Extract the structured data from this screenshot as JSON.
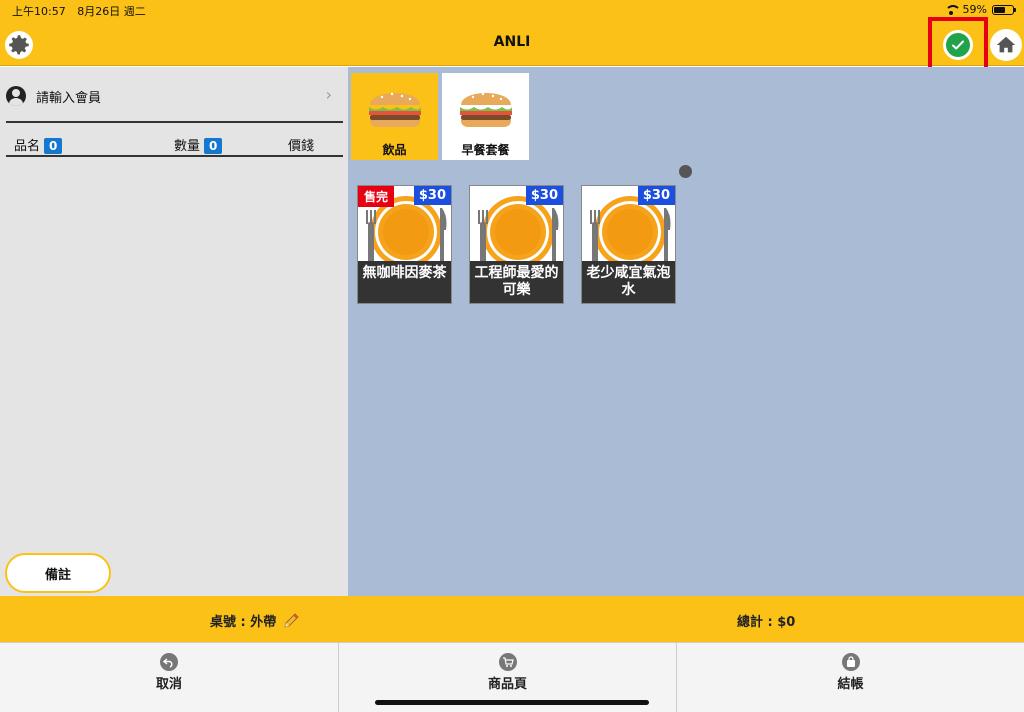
{
  "status_bar": {
    "time": "上午10:57",
    "date": "8月26日 週二",
    "battery": "59%",
    "battery_level": 0.59
  },
  "header": {
    "title": "ANLI"
  },
  "member": {
    "placeholder": "請輸入會員"
  },
  "order_columns": {
    "name": "品名",
    "name_count": "0",
    "qty": "數量",
    "qty_count": "0",
    "price": "價錢"
  },
  "note_button": "備註",
  "categories": [
    {
      "label": "飲品",
      "active": true
    },
    {
      "label": "早餐套餐",
      "active": false
    }
  ],
  "products": [
    {
      "name": "無咖啡因麥茶",
      "price": "$30",
      "badge": "售完"
    },
    {
      "name": "工程師最愛的可樂",
      "price": "$30",
      "badge": ""
    },
    {
      "name": "老少咸宜氣泡水",
      "price": "$30",
      "badge": ""
    }
  ],
  "summary": {
    "table": "桌號 : 外帶",
    "total": "總計 : $0"
  },
  "footer": {
    "cancel": "取消",
    "products": "商品頁",
    "checkout": "結帳"
  },
  "colors": {
    "accent": "#FBC117",
    "panel": "#A9BBD5",
    "highlight": "#E60012",
    "confirm": "#21A34A",
    "badge": "#1677CF"
  }
}
